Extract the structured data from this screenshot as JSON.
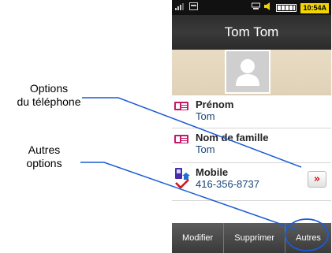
{
  "callouts": {
    "options_phone": {
      "line1": "Options",
      "line2": "du téléphone"
    },
    "other_options": {
      "line1": "Autres",
      "line2": "options"
    }
  },
  "status_bar": {
    "clock": "10:54A",
    "icons": [
      "signal-icon",
      "network-icon",
      "headset-icon",
      "volume-icon",
      "battery-icon"
    ]
  },
  "header": {
    "title": "Tom Tom"
  },
  "fields": [
    {
      "name": "Prénom",
      "value": "Tom",
      "icon": "first-name-card-icon"
    },
    {
      "name": "Nom de famille",
      "value": "Tom",
      "icon": "last-name-card-icon"
    },
    {
      "name": "Mobile",
      "value": "416-356-8737",
      "icon": "mobile-phone-icon"
    }
  ],
  "options_button": {
    "symbol": "»",
    "accent": "#d31111"
  },
  "bottom_bar": {
    "buttons": [
      "Modifier",
      "Supprimer",
      "Autres"
    ]
  },
  "colors": {
    "clock_bg": "#f3d400",
    "field_value": "#17457a",
    "card_icon": "#c61b6a",
    "highlight_ring": "#1a5bd6"
  }
}
